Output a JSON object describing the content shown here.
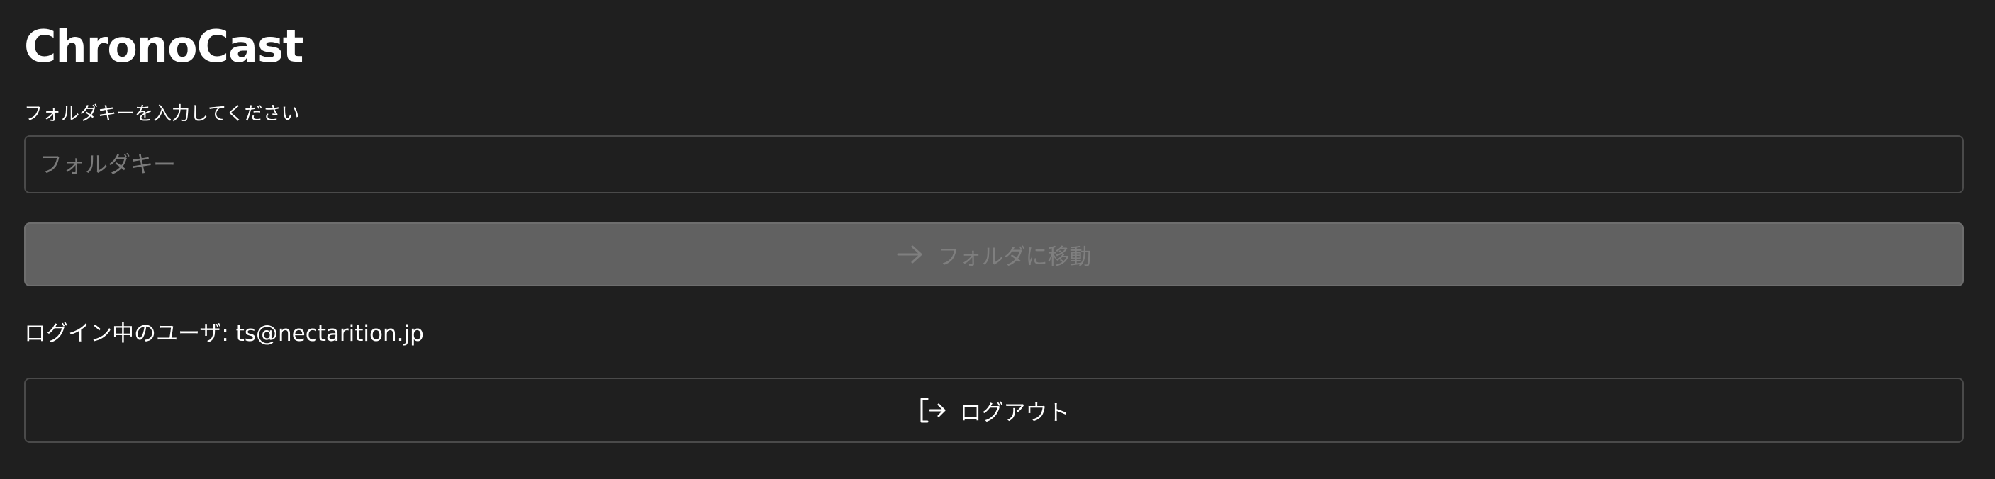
{
  "app": {
    "title": "ChronoCast"
  },
  "folder": {
    "label": "フォルダキーを入力してください",
    "input_value": "",
    "placeholder": "フォルダキー",
    "go_button_label": "フォルダに移動",
    "go_button_icon": "arrow-right-icon",
    "go_button_disabled": true
  },
  "user": {
    "line": "ログイン中のユーザ: ts@nectarition.jp"
  },
  "logout": {
    "label": "ログアウト",
    "icon": "logout-icon"
  },
  "colors": {
    "background": "#1f1f1f",
    "border": "#4a4a4a",
    "disabled_button": "#616161",
    "disabled_text": "#7f7f7f",
    "text": "#ffffff"
  }
}
